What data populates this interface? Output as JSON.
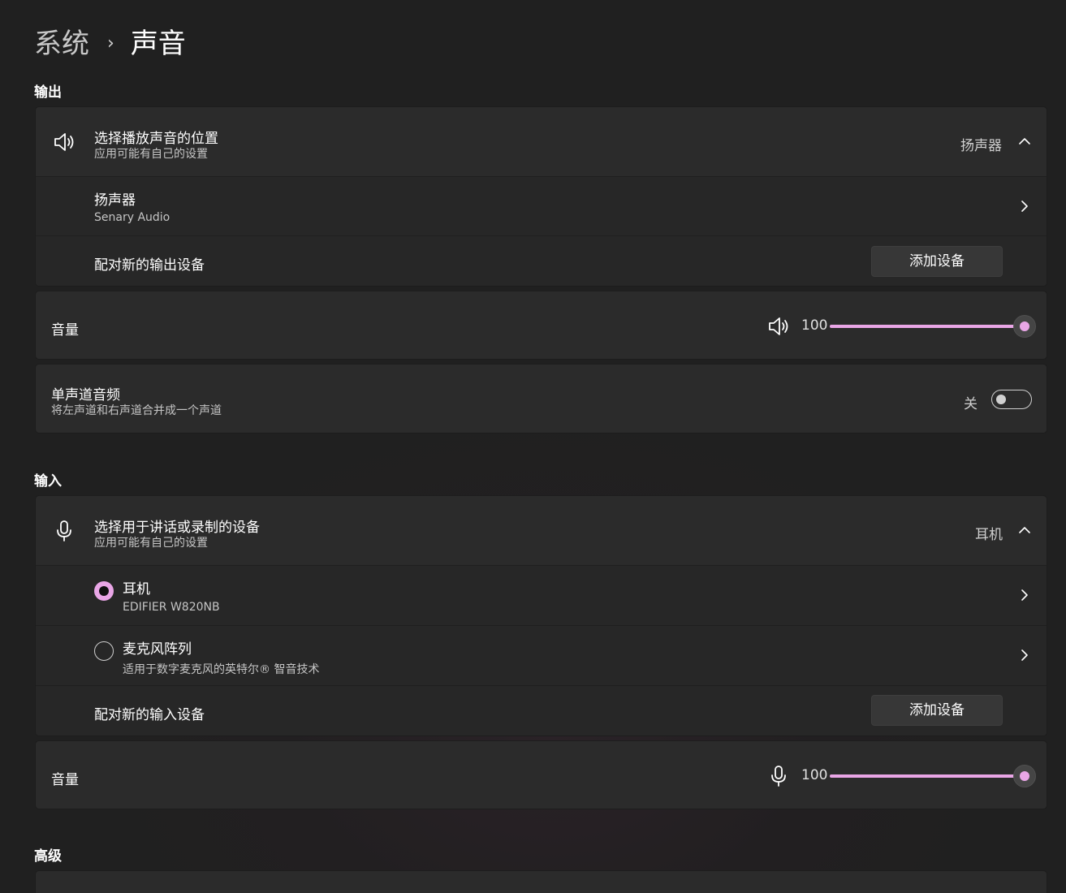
{
  "breadcrumb": {
    "parent": "系统",
    "separator": "›",
    "current": "声音"
  },
  "output": {
    "section_title": "输出",
    "select_device": {
      "icon": "speaker-icon",
      "title": "选择播放声音的位置",
      "subtitle": "应用可能有自己的设置",
      "selected": "扬声器",
      "expanded": true
    },
    "devices": [
      {
        "name": "扬声器",
        "description": "Senary Audio"
      }
    ],
    "pair": {
      "label": "配对新的输出设备",
      "button": "添加设备"
    },
    "volume": {
      "label": "音量",
      "icon": "speaker-icon",
      "value": 100,
      "value_text": "100"
    },
    "mono": {
      "title": "单声道音频",
      "subtitle": "将左声道和右声道合并成一个声道",
      "state_text": "关",
      "on": false
    }
  },
  "input": {
    "section_title": "输入",
    "select_device": {
      "icon": "microphone-icon",
      "title": "选择用于讲话或录制的设备",
      "subtitle": "应用可能有自己的设置",
      "selected": "耳机",
      "expanded": true
    },
    "devices": [
      {
        "name": "耳机",
        "description": "EDIFIER W820NB",
        "checked": true
      },
      {
        "name": "麦克风阵列",
        "description": "适用于数字麦克风的英特尔® 智音技术",
        "checked": false
      }
    ],
    "pair": {
      "label": "配对新的输入设备",
      "button": "添加设备"
    },
    "volume": {
      "label": "音量",
      "icon": "microphone-icon",
      "value": 100,
      "value_text": "100"
    }
  },
  "advanced": {
    "section_title": "高级"
  },
  "colors": {
    "accent": "#e9a6e6",
    "card": "#2b2b2b",
    "background": "#202020"
  }
}
